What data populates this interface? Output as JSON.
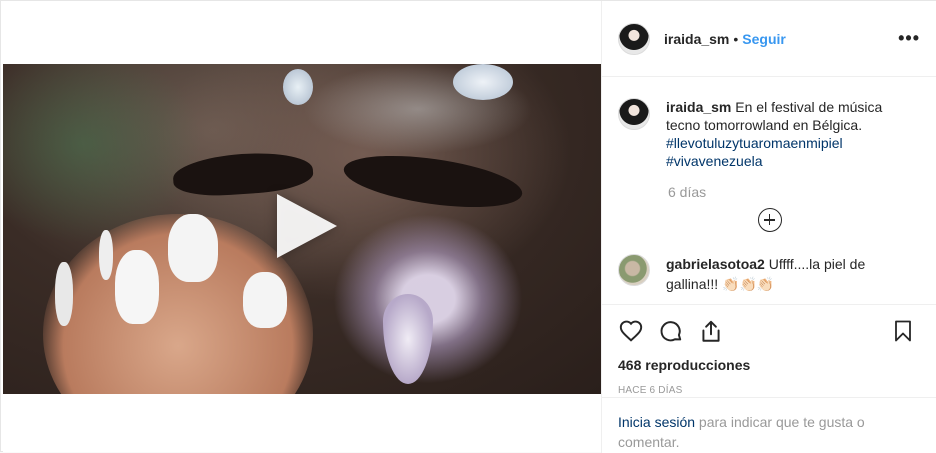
{
  "post": {
    "username": "iraida_sm",
    "separator": "•",
    "follow_label": "Seguir",
    "more_label": "•••"
  },
  "caption": {
    "username": "iraida_sm",
    "text": " En el festival de música tecno tomorrowland en Bélgica.",
    "hashtag_1": "#llevotuluzytuaromaenmipiel",
    "hashtag_2": "#vivavenezuela",
    "age": "6 días"
  },
  "comment": {
    "username": "gabrielasotoa2",
    "text": " Uffff....la piel de gallina!!! 👏🏻👏🏻👏🏻"
  },
  "stats": {
    "views_label": "468 reproducciones",
    "timestamp": "HACE 6 DÍAS"
  },
  "login": {
    "link_label": "Inicia sesión",
    "rest": " para indicar que te gusta o comentar."
  },
  "icons": {
    "play": "play-icon",
    "like": "heart-icon",
    "comment": "comment-icon",
    "share": "share-icon",
    "save": "bookmark-icon",
    "load_more": "plus-circle-icon"
  },
  "colors": {
    "link_blue": "#3897f0",
    "hashtag": "#003569",
    "muted": "#999999"
  }
}
